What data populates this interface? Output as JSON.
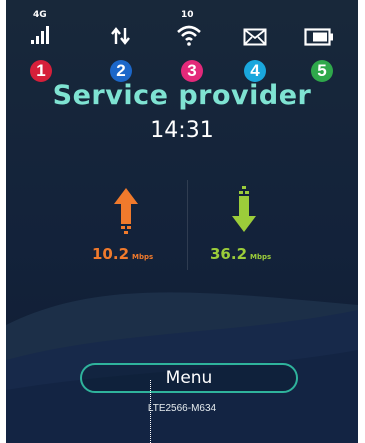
{
  "status_bar": {
    "network_type": "4G",
    "wifi_count": "10",
    "icons": [
      "signal-strength-icon",
      "data-transfer-icon",
      "wifi-icon",
      "message-icon",
      "battery-icon"
    ]
  },
  "badges": [
    {
      "label": "1",
      "color": "#d61f3a"
    },
    {
      "label": "2",
      "color": "#1c67c9"
    },
    {
      "label": "3",
      "color": "#e3297a"
    },
    {
      "label": "4",
      "color": "#1aa7dd"
    },
    {
      "label": "5",
      "color": "#2fa84b"
    }
  ],
  "header": {
    "provider": "Service provider",
    "time": "14:31"
  },
  "speeds": {
    "upload": {
      "value": "10.2",
      "unit": "Mbps",
      "color": "#f07a2c"
    },
    "download": {
      "value": "36.2",
      "unit": "Mbps",
      "color": "#9ccd3a"
    }
  },
  "menu": {
    "label": "Menu"
  },
  "device": {
    "model": "LTE2566-M634"
  },
  "colors": {
    "accent": "#7fe3d2",
    "menu_border": "#2fb39c",
    "background": "#16263a"
  }
}
